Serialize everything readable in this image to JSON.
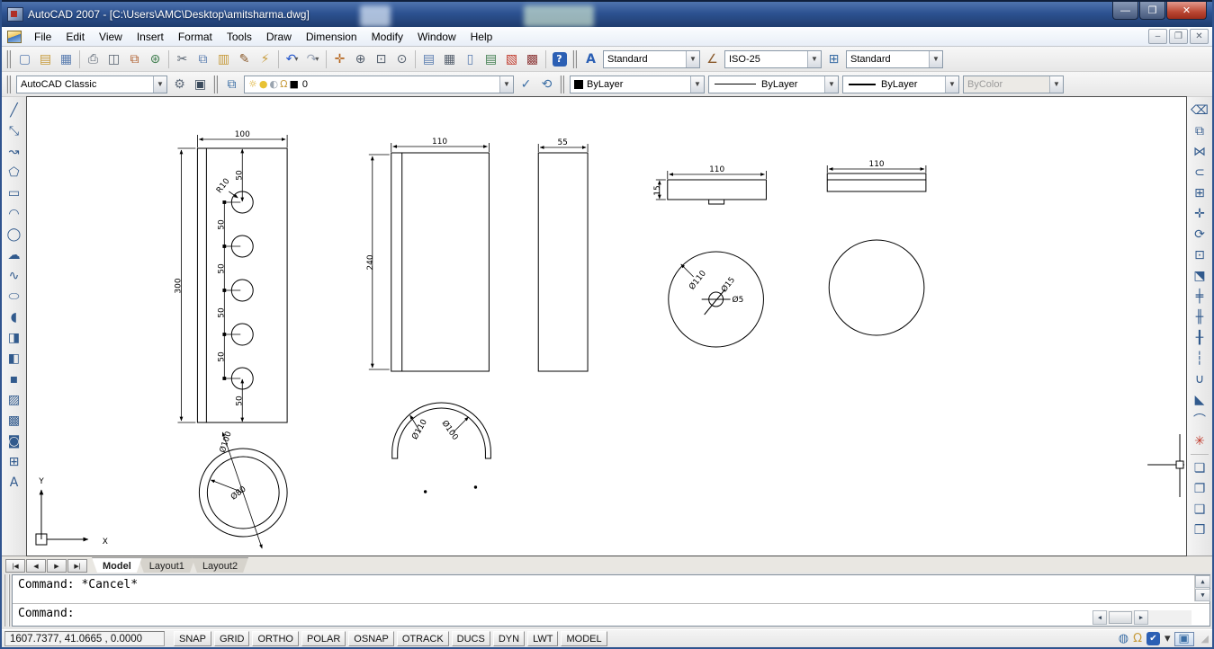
{
  "window": {
    "title": "AutoCAD 2007 - [C:\\Users\\AMC\\Desktop\\amitsharma.dwg]",
    "controls": {
      "minimize": "—",
      "restore": "❐",
      "close": "✕"
    },
    "doc_controls": {
      "minimize": "–",
      "restore": "❐",
      "close": "✕"
    }
  },
  "menu": {
    "items": [
      "File",
      "Edit",
      "View",
      "Insert",
      "Format",
      "Tools",
      "Draw",
      "Dimension",
      "Modify",
      "Window",
      "Help"
    ]
  },
  "toolbars": {
    "standard": [
      {
        "name": "new-icon",
        "glyph": "▢",
        "color": "#5a7db0"
      },
      {
        "name": "open-icon",
        "glyph": "▤",
        "color": "#c79b3b"
      },
      {
        "name": "save-icon",
        "glyph": "▦",
        "color": "#5a7db0"
      },
      {
        "name": "plot-icon",
        "glyph": "⎙",
        "color": "#55606e",
        "sep": true
      },
      {
        "name": "plot-preview-icon",
        "glyph": "◫",
        "color": "#55606e"
      },
      {
        "name": "publish-icon",
        "glyph": "⧉",
        "color": "#b06030"
      },
      {
        "name": "hyperlink-icon",
        "glyph": "⊛",
        "color": "#3f7d4e"
      },
      {
        "name": "cut-icon",
        "glyph": "✂",
        "color": "#55606e",
        "sep": true
      },
      {
        "name": "copy-icon",
        "glyph": "⧉",
        "color": "#5a7db0"
      },
      {
        "name": "paste-icon",
        "glyph": "▥",
        "color": "#c79b3b"
      },
      {
        "name": "match-properties-icon",
        "glyph": "✎",
        "color": "#8a5a2b"
      },
      {
        "name": "block-editor-icon",
        "glyph": "⚡",
        "color": "#c79b3b"
      },
      {
        "name": "undo-icon",
        "glyph": "↶",
        "color": "#2255cc",
        "sep": true,
        "dropdown": true
      },
      {
        "name": "redo-icon",
        "glyph": "↷",
        "color": "#9aa4b5",
        "dropdown": true
      },
      {
        "name": "pan-icon",
        "glyph": "✛",
        "color": "#b5651d",
        "sep": true
      },
      {
        "name": "zoom-realtime-icon",
        "glyph": "⊕",
        "color": "#55606e"
      },
      {
        "name": "zoom-window-icon",
        "glyph": "⊡",
        "color": "#55606e"
      },
      {
        "name": "zoom-previous-icon",
        "glyph": "⊙",
        "color": "#55606e"
      },
      {
        "name": "properties-icon",
        "glyph": "▤",
        "color": "#5a7db0",
        "sep": true
      },
      {
        "name": "designcenter-icon",
        "glyph": "▦",
        "color": "#55606e"
      },
      {
        "name": "tool-palettes-icon",
        "glyph": "▯",
        "color": "#5a7db0"
      },
      {
        "name": "sheet-set-manager-icon",
        "glyph": "▤",
        "color": "#3f7d4e"
      },
      {
        "name": "markup-set-manager-icon",
        "glyph": "▧",
        "color": "#c0392b"
      },
      {
        "name": "quick-calc-icon",
        "glyph": "▩",
        "color": "#8e3b3b"
      },
      {
        "name": "help-icon",
        "glyph": "?",
        "color": "#ffffff",
        "bg": "#2b5fb4",
        "sep": true
      }
    ],
    "styles": {
      "text_style": {
        "icon_glyph": "A",
        "value": "Standard"
      },
      "dim_style": {
        "icon_glyph": "∠",
        "value": "ISO-25"
      },
      "table_style": {
        "icon_glyph": "⊞",
        "value": "Standard"
      }
    },
    "workspaces": {
      "value": "AutoCAD Classic",
      "icons": [
        {
          "name": "workspace-settings-icon",
          "glyph": "⚙",
          "color": "#5f6b7a"
        },
        {
          "name": "workspace-save-icon",
          "glyph": "▣",
          "color": "#3a4a5c"
        }
      ]
    },
    "layers": {
      "panel_icon": {
        "name": "layer-properties-icon",
        "glyph": "⧉",
        "color": "#3b6ea5"
      },
      "combo_icons": [
        {
          "name": "layer-on-bulb-icon",
          "glyph": "☼",
          "color": "#d8a516"
        },
        {
          "name": "layer-freeze-sun-icon",
          "glyph": "●",
          "color": "#e8c234"
        },
        {
          "name": "layer-viewport-icon",
          "glyph": "◐",
          "color": "#9aa4af"
        },
        {
          "name": "layer-lock-icon",
          "glyph": "Ω",
          "color": "#c79b3b"
        },
        {
          "name": "layer-color-swatch",
          "glyph": "■",
          "color": "#000000"
        }
      ],
      "layer_name": "0",
      "right_icons": [
        {
          "name": "make-object-layer-current-icon",
          "glyph": "✓",
          "color": "#3b6ea5"
        },
        {
          "name": "layer-previous-icon",
          "glyph": "⟲",
          "color": "#3b6ea5"
        }
      ]
    },
    "properties": {
      "color": {
        "value": "ByLayer"
      },
      "linetype": {
        "value": "ByLayer"
      },
      "lineweight": {
        "value": "ByLayer"
      },
      "plot_style": {
        "value": "ByColor"
      }
    },
    "draw": [
      {
        "name": "line-icon",
        "glyph": "╱"
      },
      {
        "name": "construction-line-icon",
        "glyph": "⤡"
      },
      {
        "name": "polyline-icon",
        "glyph": "↝"
      },
      {
        "name": "polygon-icon",
        "glyph": "⬠"
      },
      {
        "name": "rectangle-icon",
        "glyph": "▭"
      },
      {
        "name": "arc-icon",
        "glyph": "◠"
      },
      {
        "name": "circle-icon",
        "glyph": "◯"
      },
      {
        "name": "revision-cloud-icon",
        "glyph": "☁"
      },
      {
        "name": "spline-icon",
        "glyph": "∿"
      },
      {
        "name": "ellipse-icon",
        "glyph": "⬭"
      },
      {
        "name": "ellipse-arc-icon",
        "glyph": "◖"
      },
      {
        "name": "insert-block-icon",
        "glyph": "◨"
      },
      {
        "name": "make-block-icon",
        "glyph": "◧"
      },
      {
        "name": "point-icon",
        "glyph": "▪"
      },
      {
        "name": "hatch-icon",
        "glyph": "▨"
      },
      {
        "name": "gradient-icon",
        "glyph": "▩"
      },
      {
        "name": "region-icon",
        "glyph": "◙"
      },
      {
        "name": "table-icon",
        "glyph": "⊞"
      },
      {
        "name": "multiline-text-icon",
        "glyph": "A"
      }
    ],
    "modify": [
      {
        "name": "erase-icon",
        "glyph": "⌫"
      },
      {
        "name": "copy-object-icon",
        "glyph": "⧉"
      },
      {
        "name": "mirror-icon",
        "glyph": "⋈"
      },
      {
        "name": "offset-icon",
        "glyph": "⊂"
      },
      {
        "name": "array-icon",
        "glyph": "⊞"
      },
      {
        "name": "move-icon",
        "glyph": "✛"
      },
      {
        "name": "rotate-icon",
        "glyph": "⟳"
      },
      {
        "name": "scale-icon",
        "glyph": "⊡"
      },
      {
        "name": "stretch-icon",
        "glyph": "⬔"
      },
      {
        "name": "trim-icon",
        "glyph": "╪"
      },
      {
        "name": "extend-icon",
        "glyph": "╫"
      },
      {
        "name": "break-at-point-icon",
        "glyph": "╂"
      },
      {
        "name": "break-icon",
        "glyph": "┆"
      },
      {
        "name": "join-icon",
        "glyph": "∪"
      },
      {
        "name": "chamfer-icon",
        "glyph": "◣"
      },
      {
        "name": "fillet-icon",
        "glyph": "⌒"
      },
      {
        "name": "explode-icon",
        "glyph": "✳",
        "color": "#c0392b"
      }
    ],
    "draw_order": [
      {
        "name": "bring-to-front-icon",
        "glyph": "❏"
      },
      {
        "name": "send-to-back-icon",
        "glyph": "❐"
      },
      {
        "name": "bring-above-objects-icon",
        "glyph": "❑"
      },
      {
        "name": "send-under-objects-icon",
        "glyph": "❒"
      }
    ]
  },
  "canvas": {
    "labels": {
      "width100": "100",
      "height300": "300",
      "pitch50": "50",
      "radius10": "R10",
      "width110": "110",
      "height240": "240",
      "width55": "55",
      "bar_height15": "15",
      "dia110": "Ø110",
      "dia15": "Ø15",
      "dia5": "Ø5",
      "dia100": "Ø100",
      "dia80": "Ø80"
    },
    "ucs": {
      "x": "X",
      "y": "Y"
    }
  },
  "tabs": {
    "nav": [
      "|◀",
      "◀",
      "▶",
      "▶|"
    ],
    "items": [
      {
        "label": "Model",
        "active": true
      },
      {
        "label": "Layout1",
        "active": false
      },
      {
        "label": "Layout2",
        "active": false
      }
    ]
  },
  "command_line": {
    "lines": [
      "Command: *Cancel*",
      "Command:"
    ]
  },
  "ui": {
    "scroll": {
      "up": "▲",
      "down": "▼",
      "left": "◀",
      "right": "▶"
    }
  },
  "statusbar": {
    "coordinates": "1607.7377, 41.0665 , 0.0000",
    "buttons": [
      "SNAP",
      "GRID",
      "ORTHO",
      "POLAR",
      "OSNAP",
      "OTRACK",
      "DUCS",
      "DYN",
      "LWT",
      "MODEL"
    ],
    "tray_icons": [
      {
        "name": "communication-center-icon",
        "glyph": "◍",
        "color": "#3b6ea5"
      },
      {
        "name": "toolbar-lock-icon",
        "glyph": "Ω",
        "color": "#c79b3b"
      },
      {
        "name": "associated-standards-icon",
        "glyph": "✔",
        "color": "#ffffff",
        "bg": "#2b5fb4"
      },
      {
        "name": "tray-settings-arrow-icon",
        "glyph": "▾",
        "color": "#333333"
      }
    ],
    "clean_screen_glyph": "▣"
  }
}
